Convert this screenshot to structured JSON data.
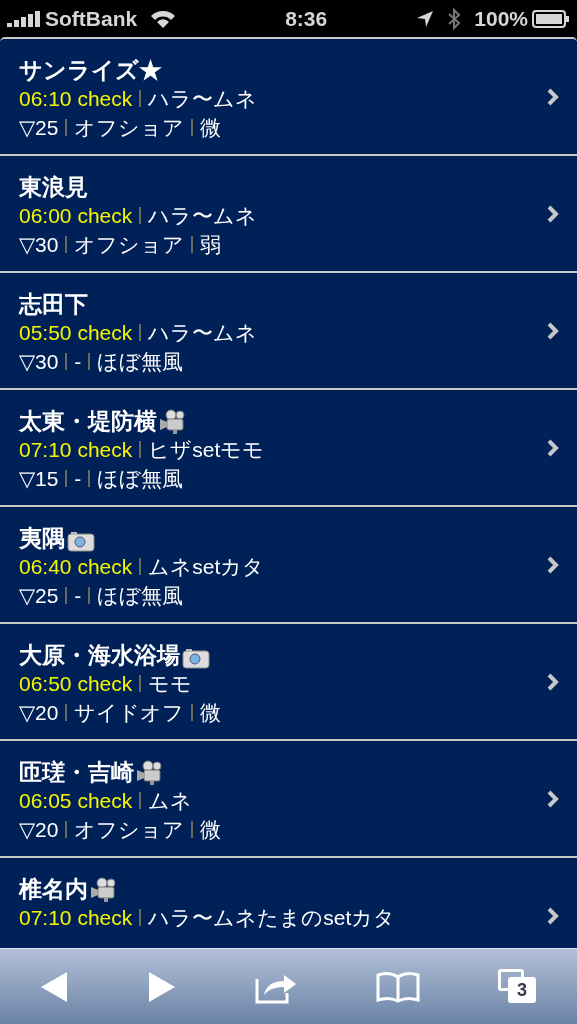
{
  "status_bar": {
    "carrier": "SoftBank",
    "time": "8:36",
    "battery": "100%"
  },
  "spots": [
    {
      "name": "サンライズ★",
      "kind": "plain",
      "check": "06:10 check",
      "size": "ハラ〜ムネ",
      "details": [
        "▽25",
        "オフショア",
        "微"
      ]
    },
    {
      "name": "東浪見",
      "kind": "plain",
      "check": "06:00 check",
      "size": "ハラ〜ムネ",
      "details": [
        "▽30",
        "オフショア",
        "弱"
      ]
    },
    {
      "name": "志田下",
      "kind": "plain",
      "check": "05:50 check",
      "size": "ハラ〜ムネ",
      "details": [
        "▽30",
        "-",
        "ほぼ無風"
      ]
    },
    {
      "name": "太東・堤防横",
      "kind": "video",
      "check": "07:10 check",
      "size": "ヒザsetモモ",
      "details": [
        "▽15",
        "-",
        "ほぼ無風"
      ]
    },
    {
      "name": "夷隅",
      "kind": "photo",
      "check": "06:40 check",
      "size": "ムネsetカタ",
      "details": [
        "▽25",
        "-",
        "ほぼ無風"
      ]
    },
    {
      "name": "大原・海水浴場",
      "kind": "photo",
      "check": "06:50 check",
      "size": "モモ",
      "details": [
        "▽20",
        "サイドオフ",
        "微"
      ]
    },
    {
      "name": "匝瑳・吉崎",
      "kind": "video",
      "check": "06:05 check",
      "size": "ムネ",
      "details": [
        "▽20",
        "オフショア",
        "微"
      ]
    },
    {
      "name": "椎名内",
      "kind": "video",
      "check": "07:10 check",
      "size": "ハラ〜ムネたまのsetカタ"
    }
  ],
  "toolbar": {
    "tab_count": "3"
  }
}
